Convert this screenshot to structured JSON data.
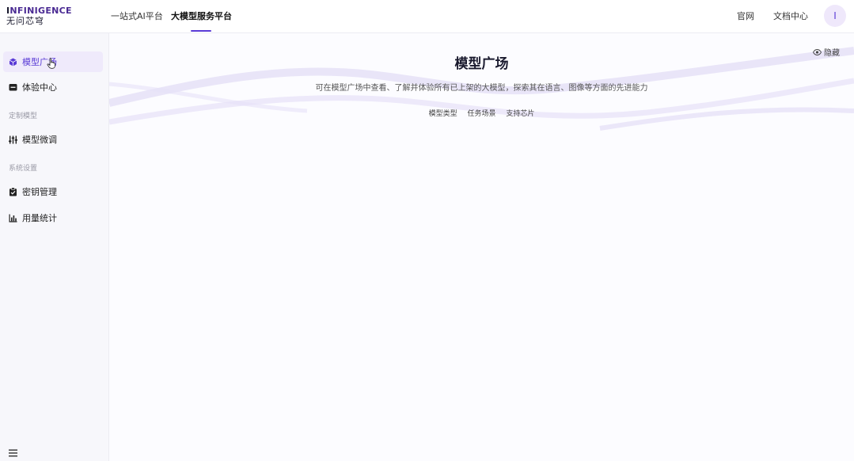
{
  "brand": {
    "logo_en_accent": "I",
    "logo_en_rest": "NFINIGENCE",
    "logo_zh": "无问芯穹"
  },
  "header": {
    "tabs": [
      {
        "label": "一站式AI平台",
        "active": false
      },
      {
        "label": "大模型服务平台",
        "active": true
      }
    ],
    "links": {
      "official_site": "官网",
      "docs": "文档中心"
    },
    "avatar_initial": "I",
    "accent_color": "#5a3bd6"
  },
  "sidebar": {
    "items": [
      {
        "label": "模型广场",
        "icon": "cube-icon",
        "active": true
      },
      {
        "label": "体验中心",
        "icon": "chat-icon",
        "active": false
      }
    ],
    "groups": [
      {
        "title": "定制模型",
        "items": [
          {
            "label": "模型微调",
            "icon": "sliders-icon"
          }
        ]
      },
      {
        "title": "系统设置",
        "items": [
          {
            "label": "密钥管理",
            "icon": "key-doc-icon"
          },
          {
            "label": "用量统计",
            "icon": "bar-chart-icon"
          }
        ]
      }
    ],
    "collapse_icon": "menu-icon"
  },
  "main": {
    "title": "模型广场",
    "description": "可在模型广场中查看、了解并体验所有已上架的大模型，探索其在语言、图像等方面的先进能力",
    "filters": [
      "模型类型",
      "任务场景",
      "支持芯片"
    ],
    "hide_button": "隐藏"
  }
}
